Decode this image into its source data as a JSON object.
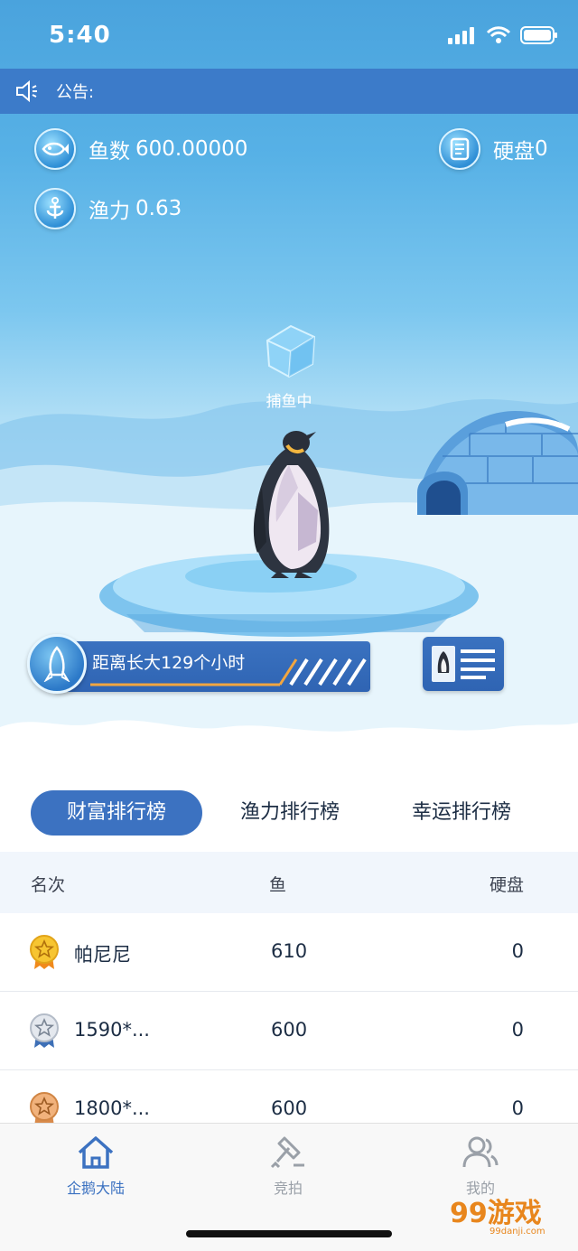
{
  "status_bar": {
    "time": "5:40"
  },
  "notice": {
    "label": "公告:"
  },
  "stats": {
    "fish_label": "鱼数",
    "fish_value": "600.00000",
    "disk_label": "硬盘",
    "disk_value": "0",
    "power_label": "渔力",
    "power_value": "0.63"
  },
  "scene": {
    "catch_status": "捕鱼中"
  },
  "growth": {
    "text": "距离长大129个小时"
  },
  "leaderboard": {
    "tabs": [
      {
        "label": "财富排行榜",
        "active": true
      },
      {
        "label": "渔力排行榜",
        "active": false
      },
      {
        "label": "幸运排行榜",
        "active": false
      }
    ],
    "headers": {
      "rank": "名次",
      "fish": "鱼",
      "disk": "硬盘"
    },
    "rows": [
      {
        "name": "帕尼尼",
        "fish": "610",
        "disk": "0",
        "medal": "gold-medal-icon"
      },
      {
        "name": "1590*...",
        "fish": "600",
        "disk": "0",
        "medal": "silver-medal-icon"
      },
      {
        "name": "1800*...",
        "fish": "600",
        "disk": "0",
        "medal": "bronze-medal-icon"
      }
    ]
  },
  "tab_bar": {
    "items": [
      {
        "label": "企鹅大陆",
        "icon": "home-icon",
        "active": true
      },
      {
        "label": "竞拍",
        "icon": "auction-hammer-icon",
        "active": false
      },
      {
        "label": "我的",
        "icon": "user-icon",
        "active": false
      }
    ]
  },
  "watermark": {
    "text": "99游戏",
    "sub": "99danji.com"
  },
  "colors": {
    "primary": "#3c72c1",
    "notice_bg": "#3c7bc9",
    "text_dark": "#1c2d44"
  }
}
